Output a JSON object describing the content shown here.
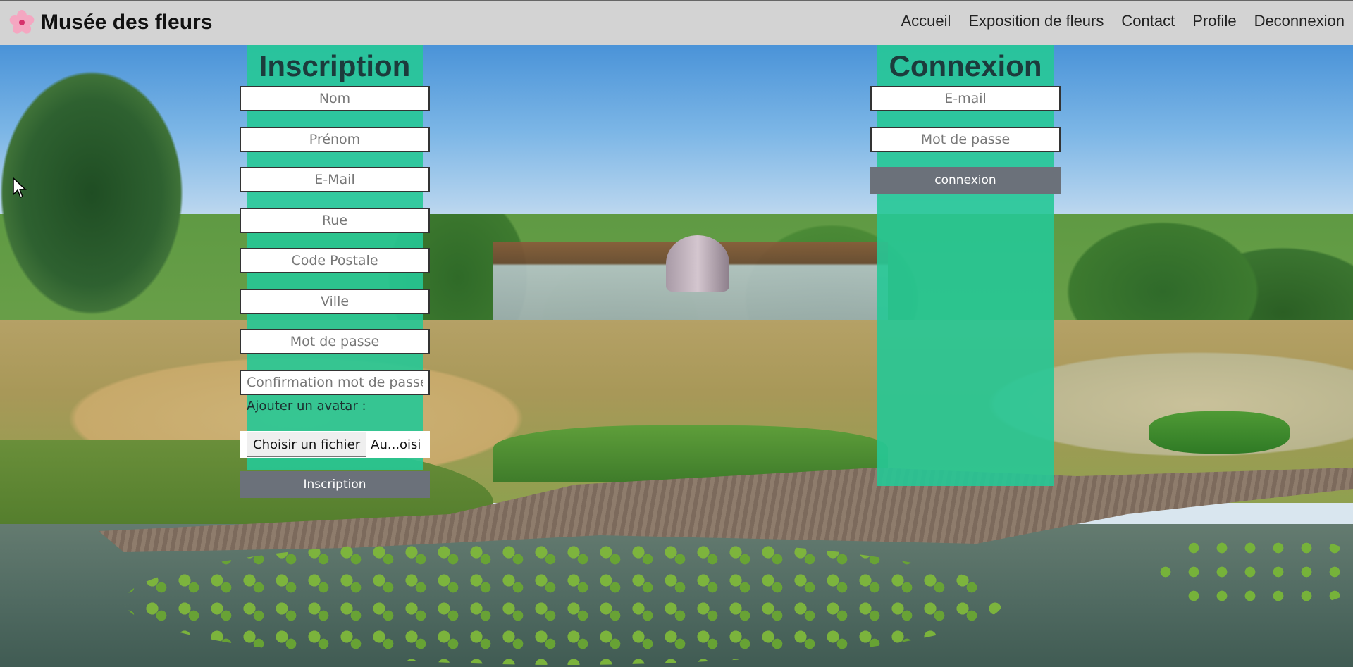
{
  "navbar": {
    "brand": "Musée des fleurs",
    "logo_icon": "cherry-blossom-icon",
    "links": [
      "Accueil",
      "Exposition de fleurs",
      "Contact",
      "Profile",
      "Deconnexion"
    ]
  },
  "inscription": {
    "title": "Inscription",
    "fields": {
      "nom": "Nom",
      "prenom": "Prénom",
      "email": "E-Mail",
      "rue": "Rue",
      "code_postale": "Code Postale",
      "ville": "Ville",
      "mot_de_passe": "Mot de passe",
      "confirmation": "Confirmation mot de passe"
    },
    "avatar_label": "Ajouter un avatar :",
    "file_button": "Choisir un fichier",
    "file_status": "Au...oisi",
    "submit": "Inscription"
  },
  "connexion": {
    "title": "Connexion",
    "fields": {
      "email": "E-mail",
      "mot_de_passe": "Mot de passe"
    },
    "submit": "connexion"
  },
  "colors": {
    "panel": "#26c896",
    "navbar": "#d3d3d3",
    "button": "#6b717a"
  }
}
